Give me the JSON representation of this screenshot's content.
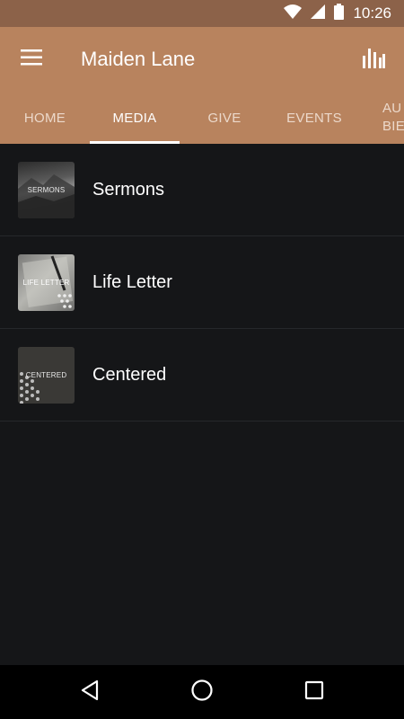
{
  "status_bar": {
    "time": "10:26",
    "icons": [
      "wifi-icon",
      "signal-icon",
      "battery-icon"
    ]
  },
  "app_bar": {
    "title": "Maiden Lane",
    "menu_icon": "hamburger-menu-icon",
    "action_icon": "bar-chart-icon"
  },
  "tabs": [
    {
      "label": "HOME",
      "active": false
    },
    {
      "label": "MEDIA",
      "active": true
    },
    {
      "label": "GIVE",
      "active": false
    },
    {
      "label": "EVENTS",
      "active": false
    },
    {
      "label_line1": "AU",
      "label_line2": "BIE",
      "active": false
    }
  ],
  "media_list": [
    {
      "title": "Sermons",
      "thumb_text": "SERMONS"
    },
    {
      "title": "Life Letter",
      "thumb_text": "LIFE LETTER"
    },
    {
      "title": "Centered",
      "thumb_text": "CENTERED"
    }
  ],
  "nav_bar": {
    "icons": [
      "back-icon",
      "home-icon",
      "recents-icon"
    ]
  },
  "colors": {
    "primary": "#b8835e",
    "status_bar": "#8c6249",
    "background": "#151618"
  }
}
